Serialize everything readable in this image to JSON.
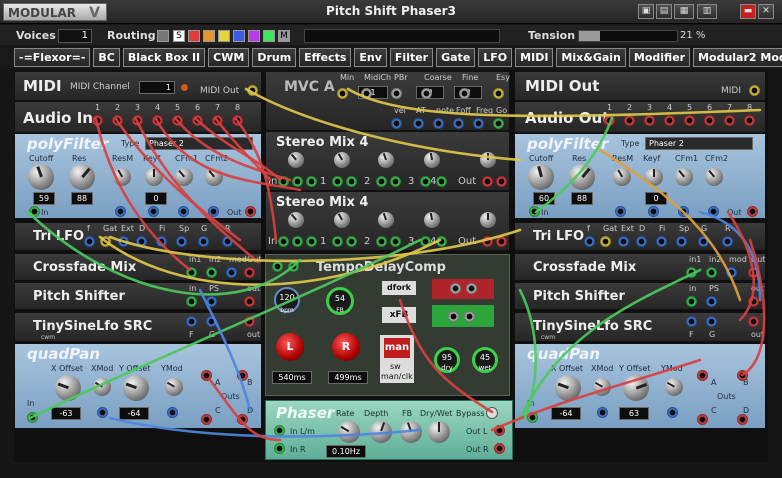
{
  "window": {
    "logo": "MODULAR",
    "logo_mark": "V",
    "title": "Pitch Shift Phaser3"
  },
  "toolbar": {
    "voices_label": "Voices",
    "voices": "1",
    "routing_label": "Routing",
    "routing_s": "S",
    "routing_m": "M",
    "tension_label": "Tension",
    "tension": "21 %",
    "tension_level": 0.21
  },
  "tabs": [
    "-=Flexor=-",
    "BC",
    "Black Box II",
    "CWM",
    "Drum",
    "Effects",
    "Env",
    "Filter",
    "Gate",
    "LFO",
    "MIDI",
    "Mix&Gain",
    "Modifier",
    "Modular2 Modules",
    "OSC",
    "Oth"
  ],
  "left": {
    "midi": {
      "title": "MIDI",
      "channel_label": "MIDI Channel",
      "channel": "1",
      "out": "MIDI Out"
    },
    "audioin": {
      "title": "Audio In",
      "ports": [
        "1",
        "2",
        "3",
        "4",
        "5",
        "6",
        "7",
        "8"
      ]
    },
    "polyfilter": {
      "title": "polyFilter",
      "type_label": "Type",
      "type": "Phaser 2",
      "cutoff": "Cutoff",
      "res": "Res",
      "resm": "ResM",
      "keyf": "Keyf",
      "cfm1": "CFm1",
      "cfm2": "CFm2",
      "cutoff_val": "59",
      "res_val": "88",
      "keyf_val": "0",
      "in": "In",
      "out": "Out"
    },
    "trilfo": {
      "title": "Tri LFO",
      "labels": [
        "f",
        "Gat",
        "Ext",
        "D",
        "Fi",
        "Sp",
        "G",
        "R"
      ]
    },
    "crossfade": {
      "title": "Crossfade Mix",
      "labels": [
        "in1",
        "in2",
        "mod",
        "Out"
      ]
    },
    "pitchshift": {
      "title": "Pitch Shifter",
      "labels": [
        "in",
        "PS",
        "out"
      ]
    },
    "tinysine": {
      "title": "TinySineLfo SRC",
      "sub": "cwm",
      "labels": [
        "F",
        "G",
        "out"
      ]
    },
    "quadpan": {
      "title": "quadPan",
      "xoff": "X Offset",
      "xmod": "XMod",
      "yoff": "Y Offset",
      "ymod": "YMod",
      "xval": "-63",
      "yval": "-64",
      "in": "In",
      "outs": "Outs",
      "abcd": [
        "A",
        "B",
        "C",
        "D"
      ]
    }
  },
  "right": {
    "midi": {
      "title": "MIDI Out",
      "sub": "MIDI"
    },
    "audioout": {
      "title": "Audio Out",
      "ports": [
        "1",
        "2",
        "3",
        "4",
        "5",
        "6",
        "7",
        "8"
      ]
    },
    "polyfilter": {
      "title": "polyFilter",
      "type_label": "Type",
      "type": "Phaser 2",
      "cutoff": "Cutoff",
      "res": "Res",
      "resm": "ResM",
      "keyf": "Keyf",
      "cfm1": "CFm1",
      "cfm2": "CFm2",
      "cutoff_val": "60",
      "res_val": "88",
      "keyf_val": "0",
      "in": "In",
      "out": "Out"
    },
    "trilfo": {
      "title": "Tri LFO",
      "labels": [
        "f",
        "Gat",
        "Ext",
        "D",
        "Fi",
        "Sp",
        "G",
        "R"
      ]
    },
    "crossfade": {
      "title": "Crossfade Mix",
      "labels": [
        "in1",
        "in2",
        "mod",
        "Out"
      ]
    },
    "pitchshift": {
      "title": "Pitch Shifter",
      "labels": [
        "in",
        "PS",
        "out"
      ]
    },
    "tinysine": {
      "title": "TinySineLfo SRC",
      "sub": "cwm",
      "labels": [
        "F",
        "G",
        "out"
      ]
    },
    "quadpan": {
      "title": "quadPan",
      "xoff": "X Offset",
      "xmod": "XMod",
      "yoff": "Y Offset",
      "ymod": "YMod",
      "xval": "-64",
      "yval": "63",
      "in": "In",
      "outs": "Outs",
      "abcd": [
        "A",
        "B",
        "C",
        "D"
      ]
    }
  },
  "center": {
    "mvca": {
      "title": "MVC A",
      "labels": [
        "Min",
        "MidiCh",
        "PBr",
        "Coarse",
        "Fine",
        "Esy"
      ],
      "midich": "1",
      "coarse": "0",
      "fine": "0",
      "row2": [
        "vel",
        "AT",
        "note",
        "Foff",
        "Freq",
        "Go"
      ]
    },
    "stereo1": {
      "title": "Stereo Mix 4",
      "labels": [
        "In",
        "1",
        "2",
        "3",
        "4",
        "Out"
      ]
    },
    "stereo2": {
      "title": "Stereo Mix 4",
      "labels": [
        "In",
        "1",
        "2",
        "3",
        "4",
        "Out"
      ]
    },
    "tempodelay": {
      "title": "TempoDelayComp",
      "bpm": "120",
      "bpm_unit": "bpm",
      "fb": "54",
      "fb_unit": "FB",
      "l": "L",
      "r": "R",
      "lms": "540ms",
      "rms": "499ms",
      "dfork": "dfork",
      "xfb": "xFB",
      "man": "man",
      "sw": "sw",
      "manclk": "man/clk",
      "dry": "95",
      "dry_label": "dry",
      "wet": "45",
      "wet_label": "wet"
    },
    "phaser": {
      "title": "Phaser",
      "labels": [
        "Rate",
        "Depth",
        "FB",
        "Dry/Wet"
      ],
      "bypass": "Bypass",
      "inlm": "In L/m",
      "inr": "In R",
      "outl": "Out L",
      "outr": "Out R",
      "rate": "0.10Hz"
    }
  },
  "colors": {
    "accent": "#e14b4b",
    "yellow": "#e4d04c",
    "green": "#4ccd5e",
    "blue": "#4c86e0",
    "panel_blue": "#8fb0cf"
  }
}
